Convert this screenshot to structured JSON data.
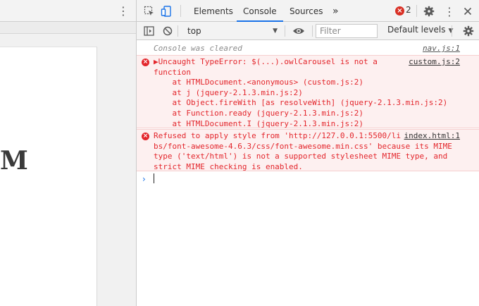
{
  "page": {
    "glyph": "M",
    "kebab": "⋮"
  },
  "devtools": {
    "tabs": [
      {
        "label": "Elements"
      },
      {
        "label": "Console"
      },
      {
        "label": "Sources"
      }
    ],
    "more_tabs": "»",
    "error_count": "2",
    "icons": {
      "inspect": "element-picker-icon",
      "device": "device-toolbar-icon",
      "settings": "gear-icon",
      "menu": "kebab-menu-icon",
      "close": "close-icon"
    }
  },
  "toolbar": {
    "context": "top",
    "filter_placeholder": "Filter",
    "levels": "Default levels",
    "arrow": "▼"
  },
  "console": {
    "cleared": {
      "text": "Console was cleared",
      "source": "nav.js:1"
    },
    "error1": {
      "lines": [
        "▶Uncaught TypeError: $(...).owlCarousel is not a",
        "function",
        "    at HTMLDocument.<anonymous> (custom.js:2)",
        "    at j (jquery-2.1.3.min.js:2)",
        "    at Object.fireWith [as resolveWith] (jquery-2.1.3.min.js:2)",
        "    at Function.ready (jquery-2.1.3.min.js:2)",
        "    at HTMLDocument.I (jquery-2.1.3.min.js:2)"
      ],
      "source": "custom.js:2"
    },
    "error2": {
      "lines": [
        "Refused to apply style from 'http://127.0.0.1:5500/li",
        "bs/font-awesome-4.6.3/css/font-awesome.min.css' because its MIME",
        "type ('text/html') is not a supported stylesheet MIME type, and",
        "strict MIME checking is enabled."
      ],
      "source": "index.html:1"
    },
    "prompt": "›"
  },
  "colors": {
    "accent": "#1a73e8",
    "error": "#e3262c",
    "error_bg": "#fdf0f0"
  }
}
